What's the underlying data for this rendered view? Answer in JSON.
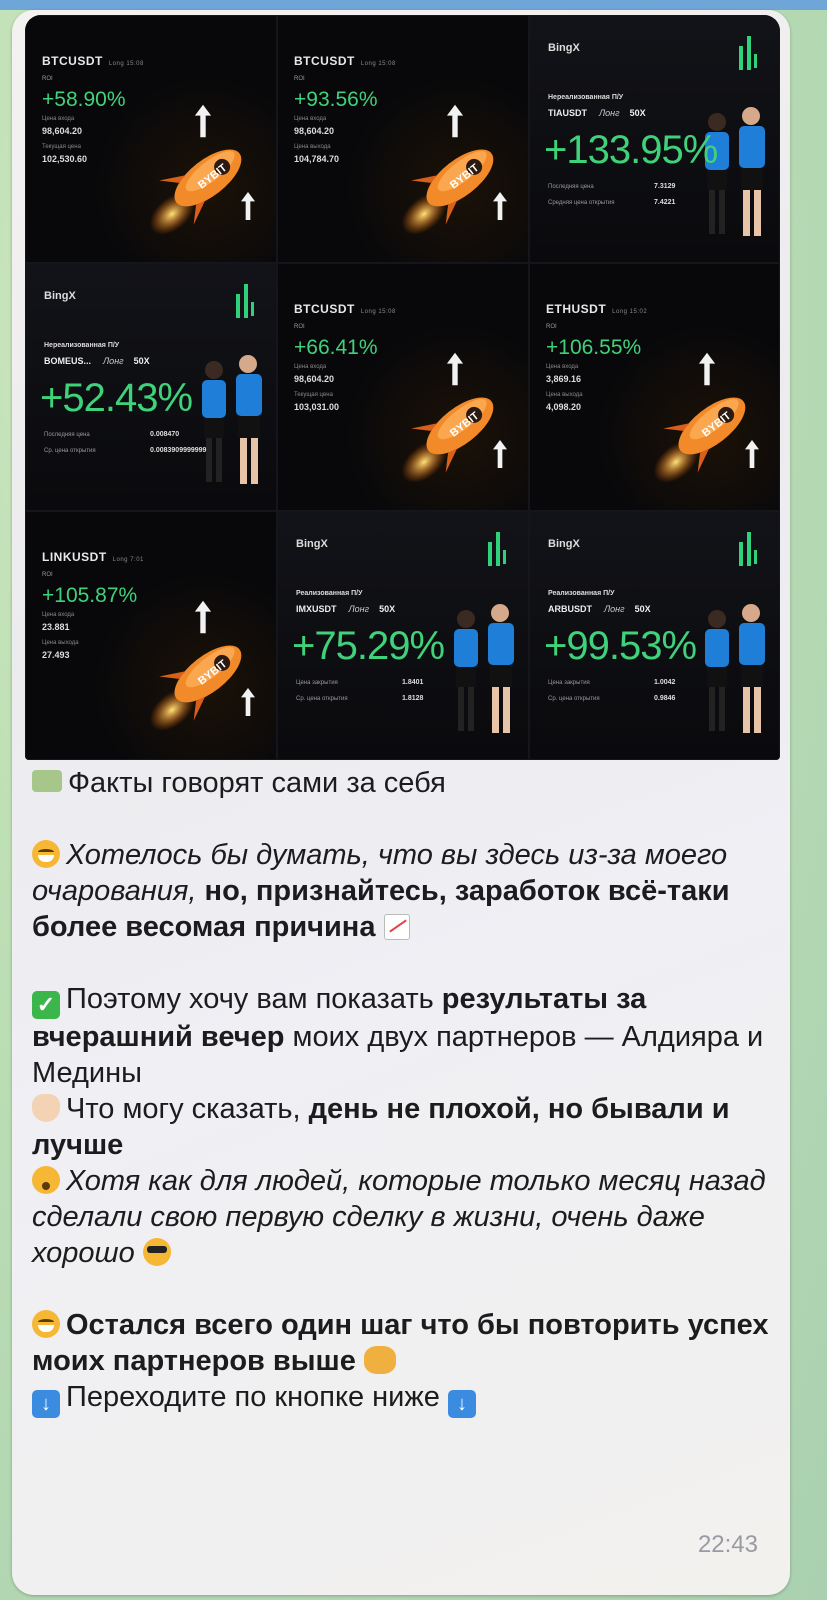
{
  "cards": [
    {
      "kind": "bybit",
      "pair": "BTCUSDT",
      "tag": "Long 15:08",
      "roi_label": "ROI",
      "roi": "+58.90%",
      "l1": "Цена входа",
      "v1": "98,604.20",
      "l2": "Текущая цена",
      "v2": "102,530.60"
    },
    {
      "kind": "bybit",
      "pair": "BTCUSDT",
      "tag": "Long 15:08",
      "roi_label": "ROI",
      "roi": "+93.56%",
      "l1": "Цена входа",
      "v1": "98,604.20",
      "l2": "Цена выхода",
      "v2": "104,784.70"
    },
    {
      "kind": "bingx",
      "logo": "BingX",
      "sub": "Нереализованная П/У",
      "pair": "TIAUSDT",
      "side": "Лонг",
      "lev": "50X",
      "roi": "+133.95%",
      "l1": "Последняя цена",
      "v1": "7.3129",
      "l2": "Средняя цена открытия",
      "v2": "7.4221"
    },
    {
      "kind": "bingx",
      "logo": "BingX",
      "sub": "Нереализованная П/У",
      "pair": "BOMEUS...",
      "side": "Лонг",
      "lev": "50X",
      "roi": "+52.43%",
      "l1": "Последняя цена",
      "v1": "0.008470",
      "l2": "Ср. цена открытия",
      "v2": "0.0083909999999"
    },
    {
      "kind": "bybit",
      "pair": "BTCUSDT",
      "tag": "Long 15:08",
      "roi_label": "ROI",
      "roi": "+66.41%",
      "l1": "Цена входа",
      "v1": "98,604.20",
      "l2": "Текущая цена",
      "v2": "103,031.00"
    },
    {
      "kind": "bybit",
      "pair": "ETHUSDT",
      "tag": "Long 15:02",
      "roi_label": "ROI",
      "roi": "+106.55%",
      "l1": "Цена входа",
      "v1": "3,869.16",
      "l2": "Цена выхода",
      "v2": "4,098.20"
    },
    {
      "kind": "bybit",
      "pair": "LINKUSDT",
      "tag": "Long 7:01",
      "roi_label": "ROI",
      "roi": "+105.87%",
      "l1": "Цена входа",
      "v1": "23.881",
      "l2": "Цена выхода",
      "v2": "27.493"
    },
    {
      "kind": "bingx",
      "logo": "BingX",
      "sub": "Реализованная П/У",
      "pair": "IMXUSDT",
      "side": "Лонг",
      "lev": "50X",
      "roi": "+75.29%",
      "l1": "Цена закрытия",
      "v1": "1.8401",
      "l2": "Ср. цена открытия",
      "v2": "1.8128"
    },
    {
      "kind": "bingx",
      "logo": "BingX",
      "sub": "Реализованная П/У",
      "pair": "ARBUSDT",
      "side": "Лонг",
      "lev": "50X",
      "roi": "+99.53%",
      "l1": "Цена закрытия",
      "v1": "1.0042",
      "l2": "Ср. цена открытия",
      "v2": "0.9846"
    }
  ],
  "message": {
    "title": "Факты говорят сами за себя",
    "p1_italic": "Хотелось бы думать, что вы здесь из-за моего очарования,",
    "p1_bold": "но, признайтесь, заработок всё-таки более весомая причина",
    "p2_a": "Поэтому хочу вам показать",
    "p2_b": "результаты за вчерашний вечер",
    "p2_c": "моих двух партнеров — Алдияра и Медины",
    "p3_a": "Что могу сказать,",
    "p3_b": "день не плохой, но бывали и лучше",
    "p4_italic": "Хотя как для людей, которые только месяц назад сделали свою первую сделку в жизни, очень даже хорошо",
    "p5_bold": "Остался всего один шаг что бы повторить успех моих партнеров выше",
    "p6": "Переходите по кнопке ниже",
    "time": "22:43"
  },
  "icons": {
    "emoji_money": "money-with-wings-icon",
    "emoji_grin": "grinning-face-icon",
    "emoji_chart": "chart-increasing-icon",
    "emoji_check": "check-mark-button-icon",
    "emoji_hand": "ok-hand-icon",
    "emoji_hush": "hushed-face-icon",
    "emoji_cool": "sunglasses-face-icon",
    "emoji_smile": "smiling-face-icon",
    "emoji_shake": "handshake-icon",
    "emoji_down": "down-arrow-button-icon"
  },
  "colors": {
    "profit_green": "#3fd27a",
    "bubble": "#f2f1ee",
    "card_bg": "#08080a"
  }
}
